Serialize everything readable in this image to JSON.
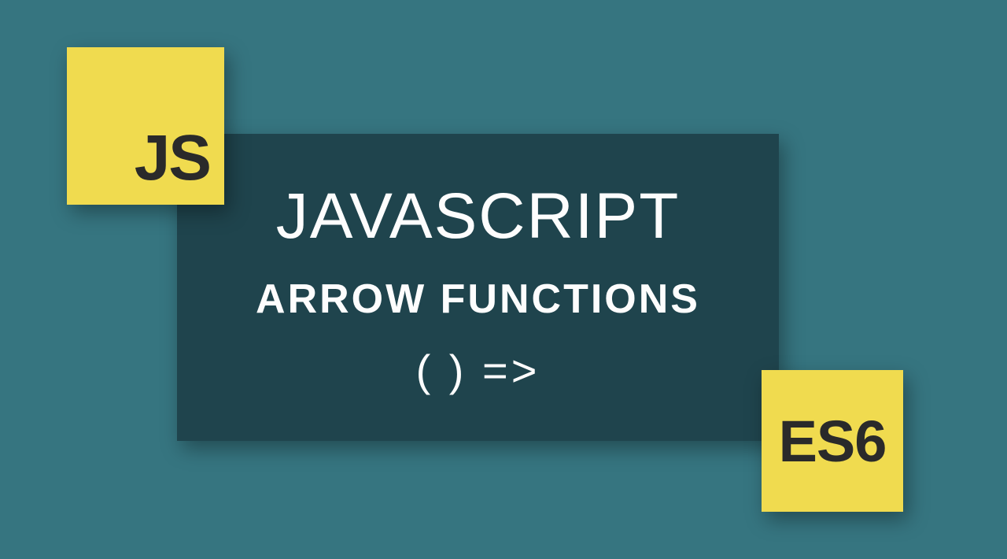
{
  "badges": {
    "js": "JS",
    "es6": "ES6"
  },
  "panel": {
    "title": "JAVASCRIPT",
    "subtitle": "ARROW FUNCTIONS",
    "snippet": "( ) =>"
  },
  "colors": {
    "background": "#367580",
    "panel": "#1f444d",
    "badge": "#f0db4f",
    "text_dark": "#2a2a2a",
    "text_light": "#fdfdfd"
  }
}
